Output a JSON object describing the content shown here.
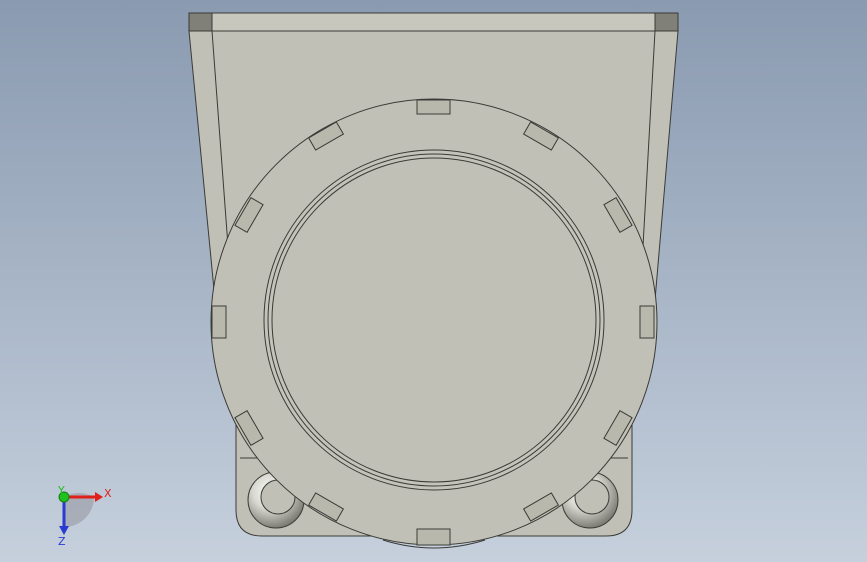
{
  "viewport": {
    "background_top": "#8a9ab0",
    "background_bottom": "#c6d0dd"
  },
  "model": {
    "body_color": "#c1c0b6",
    "edge_color": "#3a3a36",
    "tab_color": "#b9b8ad",
    "ring_color": "#cfd0c9",
    "dark_corner_color": "#808078"
  },
  "triad": {
    "x_label": "X",
    "y_label": "Y",
    "z_label": "Z",
    "x_color": "#e0201a",
    "y_color": "#20c020",
    "z_color": "#2a3ad0"
  }
}
